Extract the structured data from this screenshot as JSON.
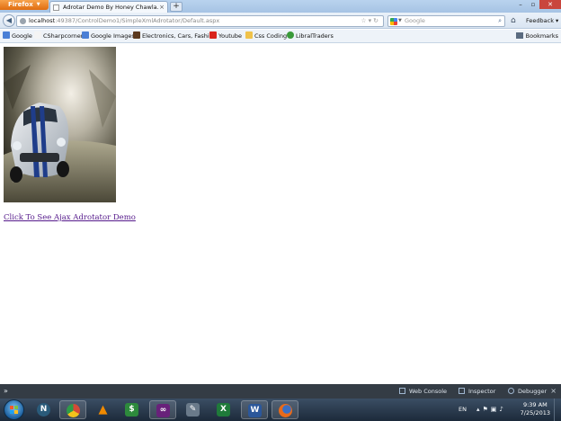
{
  "browser": {
    "menu_button": "Firefox",
    "tab_title": "Adrotar Demo By Honey Chawla.",
    "new_tab": "+",
    "url_host": "localhost",
    "url_path": ":49387/ControlDemo1/SimpleXmlAdrotator/Default.aspx",
    "search_placeholder": "Google",
    "feedback": "Feedback"
  },
  "bookmarks": {
    "items": [
      {
        "label": "Google",
        "color": "#4a7fd6"
      },
      {
        "label": "CSharpcorner",
        "color": "#f4f4f4"
      },
      {
        "label": "Google Images",
        "color": "#4a7fd6"
      },
      {
        "label": "Electronics, Cars, Fashi...",
        "color": "#5b3a1e"
      },
      {
        "label": "Youtube",
        "color": "#d9251c"
      },
      {
        "label": "Css Coding",
        "color": "#f0c24a"
      },
      {
        "label": "LibralTraders",
        "color": "#3a9a3a"
      }
    ],
    "menu": "Bookmarks"
  },
  "page": {
    "link_text": "Click To See Ajax Adrotator Demo"
  },
  "devtools": {
    "prompt": "»",
    "web_console": "Web Console",
    "inspector": "Inspector",
    "debugger": "Debugger",
    "close": "×"
  },
  "taskbar": {
    "apps": [
      {
        "name": "nero",
        "glyph": "N",
        "color": "#2a5b7a"
      },
      {
        "name": "chrome",
        "glyph": "",
        "color": "#d44a37"
      },
      {
        "name": "vlc",
        "glyph": "▲",
        "color": "#f08a00"
      },
      {
        "name": "excel-calc",
        "glyph": "$",
        "color": "#2d8a3c"
      },
      {
        "name": "visual-studio",
        "glyph": "∞",
        "color": "#68217a"
      },
      {
        "name": "tools",
        "glyph": "✎",
        "color": "#6a7a8a"
      },
      {
        "name": "excel",
        "glyph": "X",
        "color": "#1f7a3a"
      },
      {
        "name": "word",
        "glyph": "W",
        "color": "#2b579a"
      },
      {
        "name": "firefox",
        "glyph": "●",
        "color": "#e86a1a"
      }
    ],
    "language": "EN",
    "time": "9:39 AM",
    "date": "7/25/2013"
  }
}
